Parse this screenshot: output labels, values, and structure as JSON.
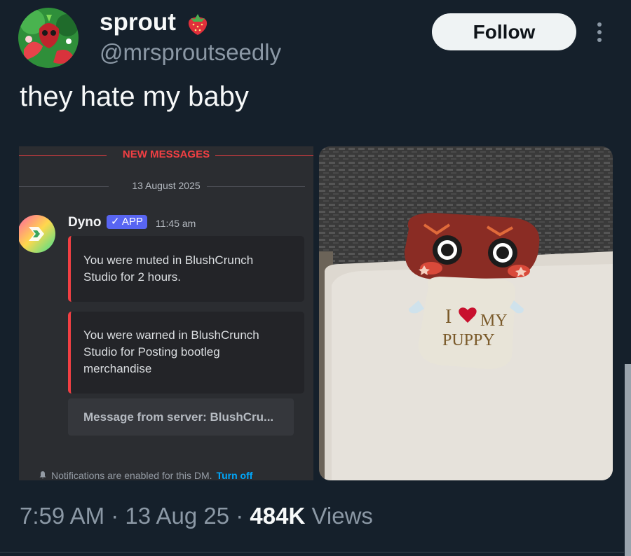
{
  "author": {
    "display_name": "sprout",
    "name_emoji": "strawberry",
    "handle": "@mrsproutseedly",
    "avatar": "avatar-image"
  },
  "follow_label": "Follow",
  "tweet": {
    "text": "they hate my baby"
  },
  "discord": {
    "new_messages_label": "NEW MESSAGES",
    "date_label": "13 August 2025",
    "bot_name": "Dyno",
    "app_badge": "✓ APP",
    "time": "11:45 am",
    "embeds": [
      {
        "lines": [
          "You were muted in BlushCrunch",
          "Studio for 2 hours."
        ]
      },
      {
        "lines": [
          "You were warned in BlushCrunch",
          "Studio for Posting bootleg",
          "merchandise"
        ]
      }
    ],
    "server_button": "Message from server: BlushCru...",
    "notification_text": "Notifications are enabled for this DM.",
    "turn_off_label": "Turn off"
  },
  "photo": {
    "shirt_text_1": "I",
    "shirt_text_2": "MY",
    "shirt_text_3": "PUPPY"
  },
  "meta": {
    "time": "7:59 AM",
    "dot": "·",
    "date": "13 Aug 25",
    "views_count": "484K",
    "views_label": "Views"
  },
  "colors": {
    "background": "#15202b",
    "discord_red": "#f23f43",
    "discord_blurple": "#5865f2",
    "link_blue": "#00a8fc"
  }
}
